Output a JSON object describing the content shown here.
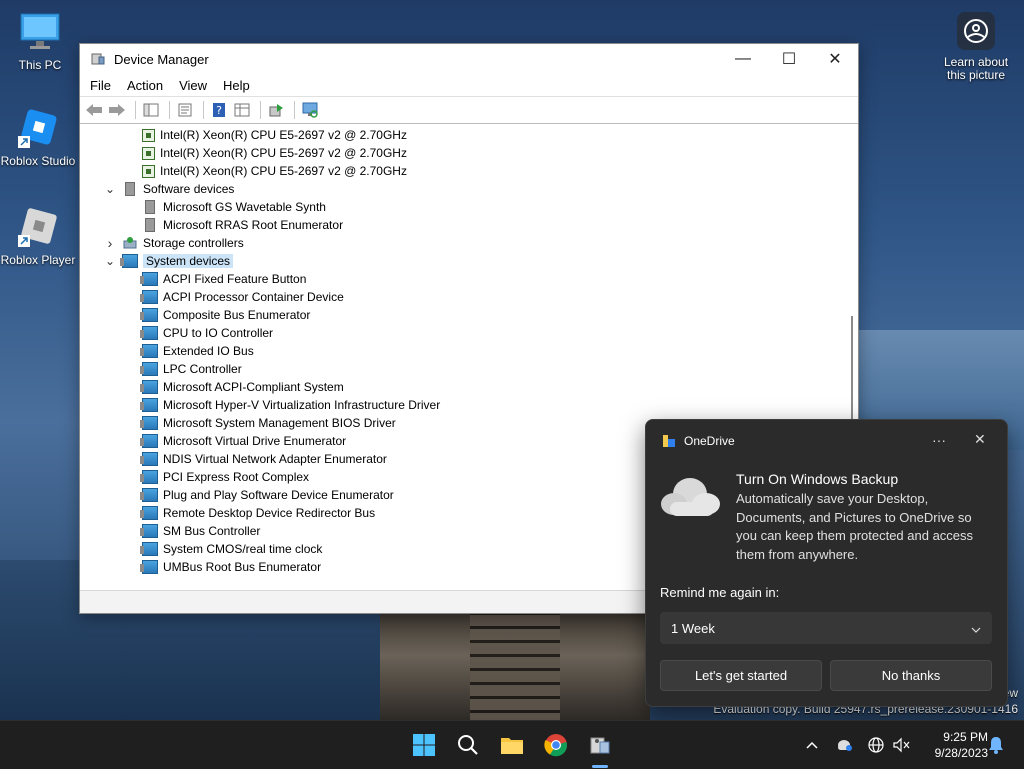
{
  "desktop": {
    "icons": [
      {
        "label": "This PC"
      },
      {
        "label": "Roblox Studio"
      },
      {
        "label": "Roblox Player"
      }
    ],
    "learn_label": "Learn about this picture",
    "watermark_line1": "ew",
    "watermark_line2": "Evaluation copy. Build 25947.rs_prerelease.230901-1416"
  },
  "window": {
    "title": "Device Manager",
    "menu": [
      "File",
      "Action",
      "View",
      "Help"
    ],
    "tree": [
      {
        "label": "Intel(R) Xeon(R) CPU E5-2697 v2 @ 2.70GHz",
        "level": 2,
        "icon": "cpu-icon"
      },
      {
        "label": "Intel(R) Xeon(R) CPU E5-2697 v2 @ 2.70GHz",
        "level": 2,
        "icon": "cpu-icon"
      },
      {
        "label": "Intel(R) Xeon(R) CPU E5-2697 v2 @ 2.70GHz",
        "level": 2,
        "icon": "cpu-icon"
      },
      {
        "label": "Software devices",
        "level": 1,
        "icon": "software-device-icon",
        "expanded": true
      },
      {
        "label": "Microsoft GS Wavetable Synth",
        "level": 2,
        "icon": "software-device-icon"
      },
      {
        "label": "Microsoft RRAS Root Enumerator",
        "level": 2,
        "icon": "software-device-icon"
      },
      {
        "label": "Storage controllers",
        "level": 1,
        "icon": "storage-controller-icon",
        "expanded": false
      },
      {
        "label": "System devices",
        "level": 1,
        "icon": "system-devices-icon",
        "expanded": true,
        "selected": true
      },
      {
        "label": "ACPI Fixed Feature Button",
        "level": 2,
        "icon": "system-device-icon"
      },
      {
        "label": "ACPI Processor Container Device",
        "level": 2,
        "icon": "system-device-icon"
      },
      {
        "label": "Composite Bus Enumerator",
        "level": 2,
        "icon": "system-device-icon"
      },
      {
        "label": "CPU to IO Controller",
        "level": 2,
        "icon": "system-device-icon"
      },
      {
        "label": "Extended IO Bus",
        "level": 2,
        "icon": "system-device-icon"
      },
      {
        "label": "LPC Controller",
        "level": 2,
        "icon": "system-device-icon"
      },
      {
        "label": "Microsoft ACPI-Compliant System",
        "level": 2,
        "icon": "system-device-icon"
      },
      {
        "label": "Microsoft Hyper-V Virtualization Infrastructure Driver",
        "level": 2,
        "icon": "system-device-icon"
      },
      {
        "label": "Microsoft System Management BIOS Driver",
        "level": 2,
        "icon": "system-device-icon"
      },
      {
        "label": "Microsoft Virtual Drive Enumerator",
        "level": 2,
        "icon": "system-device-icon"
      },
      {
        "label": "NDIS Virtual Network Adapter Enumerator",
        "level": 2,
        "icon": "system-device-icon"
      },
      {
        "label": "PCI Express Root Complex",
        "level": 2,
        "icon": "system-device-icon"
      },
      {
        "label": "Plug and Play Software Device Enumerator",
        "level": 2,
        "icon": "system-device-icon"
      },
      {
        "label": "Remote Desktop Device Redirector Bus",
        "level": 2,
        "icon": "system-device-icon"
      },
      {
        "label": "SM Bus Controller",
        "level": 2,
        "icon": "system-device-icon"
      },
      {
        "label": "System CMOS/real time clock",
        "level": 2,
        "icon": "system-device-icon"
      },
      {
        "label": "UMBus Root Bus Enumerator",
        "level": 2,
        "icon": "system-device-icon"
      }
    ]
  },
  "toast": {
    "app": "OneDrive",
    "more": "···",
    "close": "✕",
    "title": "Turn On Windows Backup",
    "body": "Automatically save your Desktop, Documents, and Pictures to OneDrive so you can keep them protected and access them from anywhere.",
    "remind_label": "Remind me again in:",
    "remind_value": "1 Week",
    "primary_button": "Let's get started",
    "secondary_button": "No thanks"
  },
  "taskbar": {
    "time": "9:25 PM",
    "date": "9/28/2023"
  },
  "colors": {
    "selection": "#cce4f7",
    "toast_bg": "#2b2b2b",
    "taskbar_bg": "#1f1f1f",
    "accent": "#0078d4"
  }
}
